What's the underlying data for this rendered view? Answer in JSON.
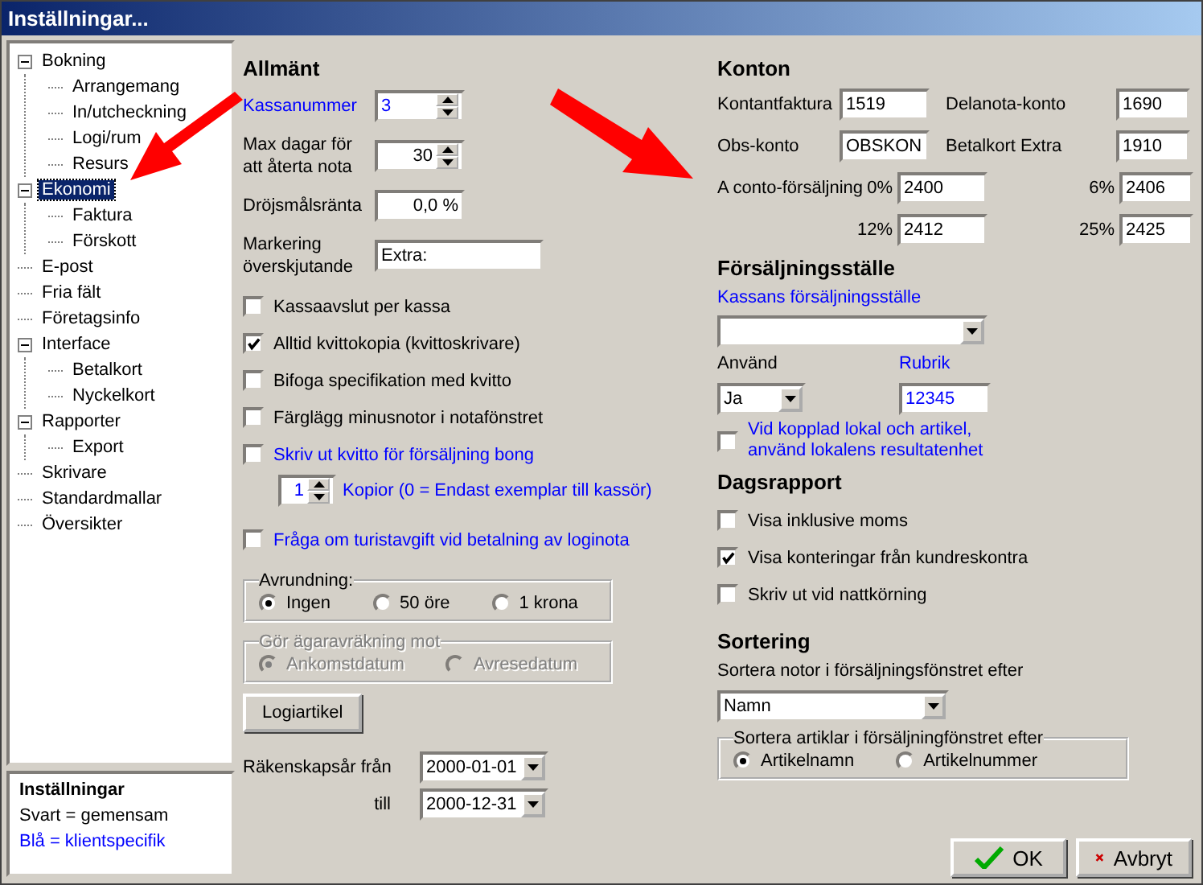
{
  "window": {
    "title": "Inställningar..."
  },
  "tree": [
    {
      "label": "Bokning",
      "selected": false,
      "expanded": true,
      "children": [
        {
          "label": "Arrangemang",
          "selected": false
        },
        {
          "label": "In/utcheckning",
          "selected": false
        },
        {
          "label": "Logi/rum",
          "selected": false
        },
        {
          "label": "Resurs",
          "selected": false
        }
      ]
    },
    {
      "label": "Ekonomi",
      "selected": true,
      "expanded": true,
      "children": [
        {
          "label": "Faktura",
          "selected": false
        },
        {
          "label": "Förskott",
          "selected": false
        }
      ]
    },
    {
      "label": "E-post",
      "selected": false
    },
    {
      "label": "Fria fält",
      "selected": false
    },
    {
      "label": "Företagsinfo",
      "selected": false
    },
    {
      "label": "Interface",
      "selected": false,
      "expanded": true,
      "children": [
        {
          "label": "Betalkort",
          "selected": false
        },
        {
          "label": "Nyckelkort",
          "selected": false
        }
      ]
    },
    {
      "label": "Rapporter",
      "selected": false,
      "expanded": true,
      "children": [
        {
          "label": "Export",
          "selected": false
        }
      ]
    },
    {
      "label": "Skrivare",
      "selected": false
    },
    {
      "label": "Standardmallar",
      "selected": false
    },
    {
      "label": "Översikter",
      "selected": false
    }
  ],
  "legend": {
    "title": "Inställningar",
    "lines": [
      {
        "text": "Svart = gemensam",
        "client": false
      },
      {
        "text": "Blå = klientspecifik",
        "client": true
      }
    ]
  },
  "general": {
    "heading": "Allmänt",
    "fields": [
      {
        "label": "Kassanummer",
        "value": "3",
        "kind": "spin",
        "client": true
      },
      {
        "label": "Max dagar för att återta nota",
        "value": "30",
        "kind": "spin",
        "client": false
      },
      {
        "label": "Dröjsmålsränta",
        "value": "0,0 %",
        "kind": "number",
        "client": false
      },
      {
        "label": "Markering överskjutande",
        "value": "Extra:",
        "kind": "text",
        "client": false
      }
    ],
    "checkboxes": [
      {
        "label": "Kassaavslut per kassa",
        "checked": false,
        "client": false
      },
      {
        "label": "Alltid kvittokopia (kvittoskrivare)",
        "checked": true,
        "client": false
      },
      {
        "label": "Bifoga specifikation med kvitto",
        "checked": false,
        "client": false
      },
      {
        "label": "Färglägg minusnotor i notafönstret",
        "checked": false,
        "client": false
      },
      {
        "label": "Skriv ut kvitto för försäljning bong",
        "checked": false,
        "client": true
      }
    ],
    "copies": {
      "value": "1",
      "label": "Kopior (0 = Endast exemplar till kassör)",
      "client": true
    },
    "tourist": {
      "label": "Fråga om turistavgift vid betalning av loginota",
      "checked": false,
      "client": true
    },
    "groups": [
      {
        "title": "Avrundning:",
        "disabled": false,
        "options": [
          {
            "label": "Ingen",
            "selected": true
          },
          {
            "label": "50 öre",
            "selected": false
          },
          {
            "label": "1 krona",
            "selected": false
          }
        ]
      },
      {
        "title": "Gör ägaravräkning mot",
        "disabled": true,
        "options": [
          {
            "label": "Ankomstdatum",
            "selected": true
          },
          {
            "label": "Avresedatum",
            "selected": false
          }
        ]
      }
    ],
    "button": "Logiartikel",
    "fiscal": [
      {
        "label": "Räkenskapsår från",
        "value": "2000-01-01"
      },
      {
        "label": "till",
        "value": "2000-12-31"
      }
    ]
  },
  "accounts": {
    "heading": "Konton",
    "rows": [
      {
        "kind": "pair",
        "items": [
          {
            "label": "Kontantfaktura",
            "value": "1519"
          },
          {
            "label": "Delanota-konto",
            "value": "1690"
          }
        ]
      },
      {
        "kind": "pair",
        "items": [
          {
            "label": "Obs-konto",
            "value": "OBSKON"
          },
          {
            "label": "Betalkort Extra",
            "value": "1910"
          }
        ]
      },
      {
        "kind": "percent",
        "title": "A conto-försäljning",
        "items": [
          {
            "label": "0%",
            "value": "2400"
          },
          {
            "label": "6%",
            "value": "2406"
          }
        ]
      },
      {
        "kind": "percent",
        "items": [
          {
            "label": "12%",
            "value": "2412"
          },
          {
            "label": "25%",
            "value": "2425"
          }
        ]
      }
    ]
  },
  "sales_point": {
    "heading": "Försäljningsställe",
    "label": "Kassans försäljningsställe",
    "client": true,
    "use": {
      "label": "Använd",
      "value": "Ja",
      "client": false
    },
    "rubric": {
      "label": "Rubrik",
      "value": "12345",
      "client": true
    },
    "linked": {
      "label": "Vid kopplad lokal och artikel, använd lokalens resultatenhet",
      "checked": false,
      "client": true
    }
  },
  "daily_report": {
    "heading": "Dagsrapport",
    "checkboxes": [
      {
        "label": "Visa inklusive moms",
        "checked": false,
        "client": false
      },
      {
        "label": "Visa konteringar från kundreskontra",
        "checked": true,
        "client": false
      },
      {
        "label": "Skriv ut vid nattkörning",
        "checked": false,
        "client": false
      }
    ]
  },
  "sorting": {
    "heading": "Sortering",
    "label": "Sortera notor i försäljningsfönstret efter",
    "value": "Namn",
    "group": {
      "title": "Sortera artiklar i försäljningfönstret efter",
      "disabled": false,
      "options": [
        {
          "label": "Artikelnamn",
          "selected": true
        },
        {
          "label": "Artikelnummer",
          "selected": false
        }
      ]
    }
  },
  "buttons": [
    {
      "label": "OK",
      "kind": "ok"
    },
    {
      "label": "Avbryt",
      "kind": "cancel"
    }
  ]
}
